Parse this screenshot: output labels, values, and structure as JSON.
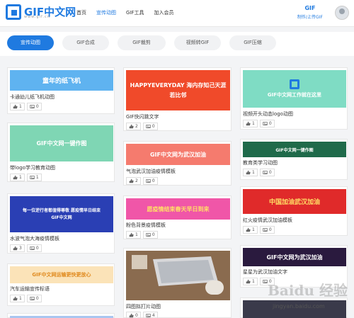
{
  "header": {
    "logo_text": "GIF中文网",
    "logo_sub": "www.gif.cn",
    "nav": [
      "首页",
      "宣传动图",
      "GIF工具",
      "加入会员"
    ],
    "nav_active_index": 1,
    "right_title": "GIF",
    "right_tag": "制作/上传GIF"
  },
  "tabs": [
    "宣传动图",
    "GIF合成",
    "GIF裁剪",
    "视频转GIF",
    "GIF压缩"
  ],
  "tabs_active_index": 0,
  "cards": [
    {
      "thumb_text": "童年的纸飞机",
      "title": "卡通幼儿纸飞机动图",
      "likes": "1",
      "views": "0",
      "bg": "#5fb3f0",
      "fg": "#ffffff"
    },
    {
      "thumb_text": "GIF中文网一键作图",
      "title": "带logo学习教育动图",
      "likes": "1",
      "views": "1",
      "bg": "#7fd6b4",
      "fg": "#ffffff"
    },
    {
      "thumb_text": "每一位逆行者都值得尊敬 愿疫情早日结束 GIF中文网",
      "title": "水波气泡大海疫情模板",
      "likes": "3",
      "views": "0",
      "bg": "#2a3fb4",
      "fg": "#ffffff"
    },
    {
      "thumb_text": "GIF中文网运输更快更放心",
      "title": "汽车运输宣传标语",
      "likes": "1",
      "views": "0",
      "bg": "#fbe3b8",
      "fg": "#e08a1e"
    },
    {
      "thumb_text": "HAPPYEVERYDAY 海内存知己天涯若比邻",
      "title": "GIF快闪跳文字",
      "likes": "2",
      "views": "0",
      "bg": "#f04a2a",
      "fg": "#ffffff"
    },
    {
      "thumb_text": "GIF中文网为武汉加油",
      "title": "气泡武汉加油疫情模板",
      "likes": "2",
      "views": "0",
      "bg": "#f57b6e",
      "fg": "#ffffff"
    },
    {
      "thumb_text": "愿疫情结束春天早日到来",
      "title": "粉色背景疫情模板",
      "likes": "1",
      "views": "0",
      "bg": "#f056a8",
      "fg": "#ffe066"
    },
    {
      "thumb_text": "",
      "title": "四图拟打片动图",
      "likes": "0",
      "views": "4",
      "bg": "#8a6a4e",
      "fg": "#ffffff"
    },
    {
      "thumb_text": "GIF中文网工作就在这里",
      "title": "视频开头动态logo动图",
      "likes": "1",
      "views": "0",
      "bg": "#7fdcc4",
      "fg": "#ffffff"
    },
    {
      "thumb_text": "GIF中文网一键作图",
      "title": "教育类学习动图",
      "likes": "1",
      "views": "0",
      "bg": "#1f6a4a",
      "fg": "#ffffff"
    },
    {
      "thumb_text": "中国加油武汉加油",
      "title": "红火疫情武汉加油模板",
      "likes": "1",
      "views": "0",
      "bg": "#e02a2a",
      "fg": "#ffe066"
    },
    {
      "thumb_text": "GIF中文网为武汉加油",
      "title": "星星为武汉加油文字",
      "likes": "1",
      "views": "0",
      "bg": "#2a1a3e",
      "fg": "#ffffff"
    },
    {
      "thumb_text": "",
      "title": "",
      "likes": "",
      "views": "",
      "bg": "#3a3a4a",
      "fg": "#ffffff"
    }
  ],
  "watermark": "Baidu 经验",
  "watermark_url": "jingyan.baidu.com"
}
